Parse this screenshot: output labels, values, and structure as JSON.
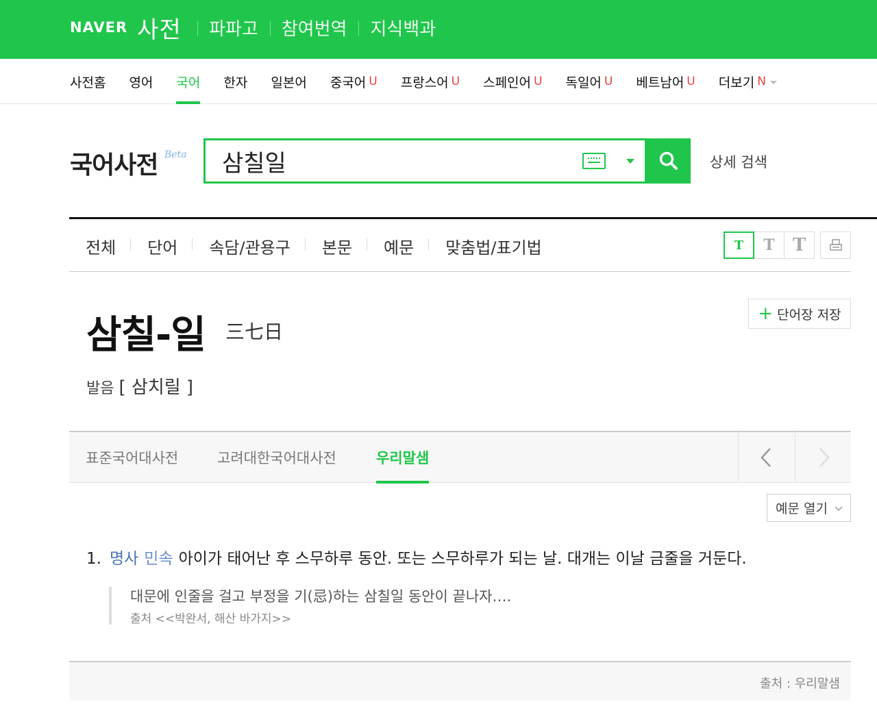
{
  "header": {
    "naver_logo": "NAVER",
    "service_title": "사전",
    "links": [
      "파파고",
      "참여번역",
      "지식백과"
    ]
  },
  "langnav": {
    "items": [
      {
        "label": "사전홈",
        "badge": ""
      },
      {
        "label": "영어",
        "badge": ""
      },
      {
        "label": "국어",
        "badge": "",
        "active": true
      },
      {
        "label": "한자",
        "badge": ""
      },
      {
        "label": "일본어",
        "badge": ""
      },
      {
        "label": "중국어",
        "badge": "U"
      },
      {
        "label": "프랑스어",
        "badge": "U"
      },
      {
        "label": "스페인어",
        "badge": "U"
      },
      {
        "label": "독일어",
        "badge": "U"
      },
      {
        "label": "베트남어",
        "badge": "U"
      },
      {
        "label": "더보기",
        "badge": "N"
      }
    ]
  },
  "search": {
    "dict_title": "국어사전",
    "beta": "Beta",
    "query": "삼칠일",
    "detail_search": "상세 검색"
  },
  "search_tabs": [
    "전체",
    "단어",
    "속담/관용구",
    "본문",
    "예문",
    "맞춤법/표기법"
  ],
  "font_size_buttons": [
    "T",
    "T",
    "T"
  ],
  "entry": {
    "word": "삼칠-일",
    "hanja": "三七日",
    "save_label": "단어장 저장",
    "pron_label": "발음",
    "pron_value": "[ 삼치릴 ]"
  },
  "source_tabs": [
    {
      "label": "표준국어대사전",
      "active": false
    },
    {
      "label": "고려대한국어대사전",
      "active": false
    },
    {
      "label": "우리말샘",
      "active": true
    }
  ],
  "example_toggle": "예문 열기",
  "definition": {
    "number": "1.",
    "pos": "명사",
    "field": "민속",
    "text": "아이가 태어난 후 스무하루 동안. 또는 스무하루가 되는 날. 대개는 이날 금줄을 거둔다."
  },
  "example": {
    "text": "대문에 인줄을 걸고 부정을 기(忌)하는 삼칠일 동안이 끝나자….",
    "source": "출처 <<박완서, 해산 바가지>>"
  },
  "footer_source": "출처 : 우리말샘",
  "colors": {
    "brand_green": "#1fc64b",
    "badge_red": "#e84142",
    "pos_blue": "#4a74b6"
  }
}
